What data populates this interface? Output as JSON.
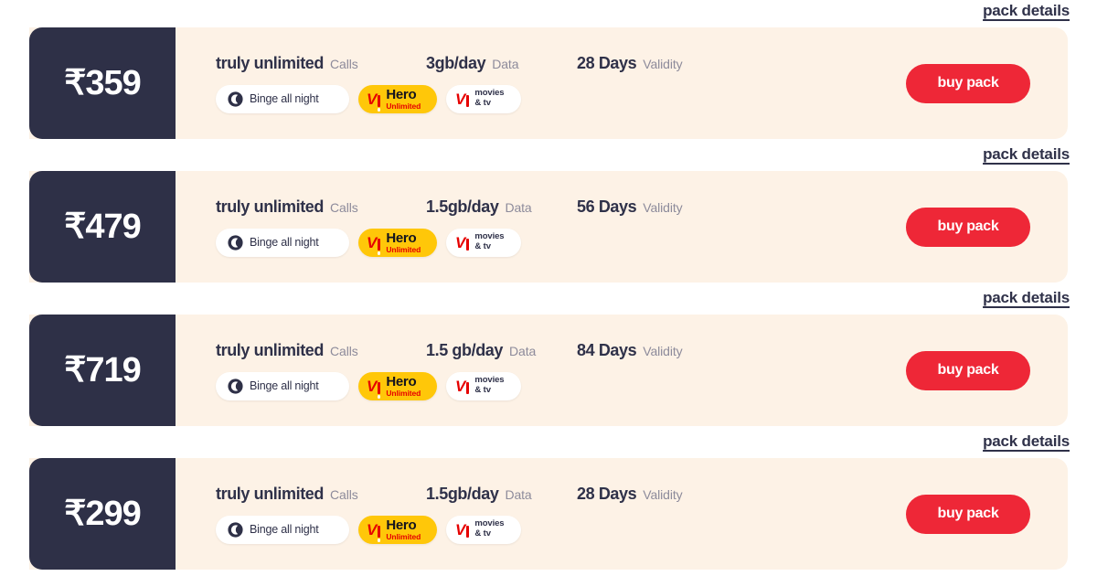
{
  "labels": {
    "pack_details": "pack details",
    "buy_pack": "buy pack",
    "calls_label": "Calls",
    "data_label": "Data",
    "validity_label": "Validity",
    "binge_badge": "Binge all night",
    "hero_badge_word": "Hero",
    "hero_badge_sub": "Unlimited",
    "movies_badge_line1": "movies",
    "movies_badge_line2": "& tv",
    "vi_logo_text": "VI"
  },
  "colors": {
    "price_pane": "#2e3047",
    "card_background": "#fdf2e6",
    "buy_button": "#ee2737",
    "hero_badge": "#ffc709",
    "vi_red": "#e60000",
    "label_gray": "#8d8b9b",
    "page_background": "#ffffff"
  },
  "plans": [
    {
      "price": "₹359",
      "calls_value": "truly unlimited",
      "data_value": "3gb/day",
      "validity_value": "28 Days"
    },
    {
      "price": "₹479",
      "calls_value": "truly unlimited",
      "data_value": "1.5gb/day",
      "validity_value": "56 Days"
    },
    {
      "price": "₹719",
      "calls_value": "truly unlimited",
      "data_value": "1.5 gb/day",
      "validity_value": "84 Days"
    },
    {
      "price": "₹299",
      "calls_value": "truly unlimited",
      "data_value": "1.5gb/day",
      "validity_value": "28 Days"
    }
  ]
}
